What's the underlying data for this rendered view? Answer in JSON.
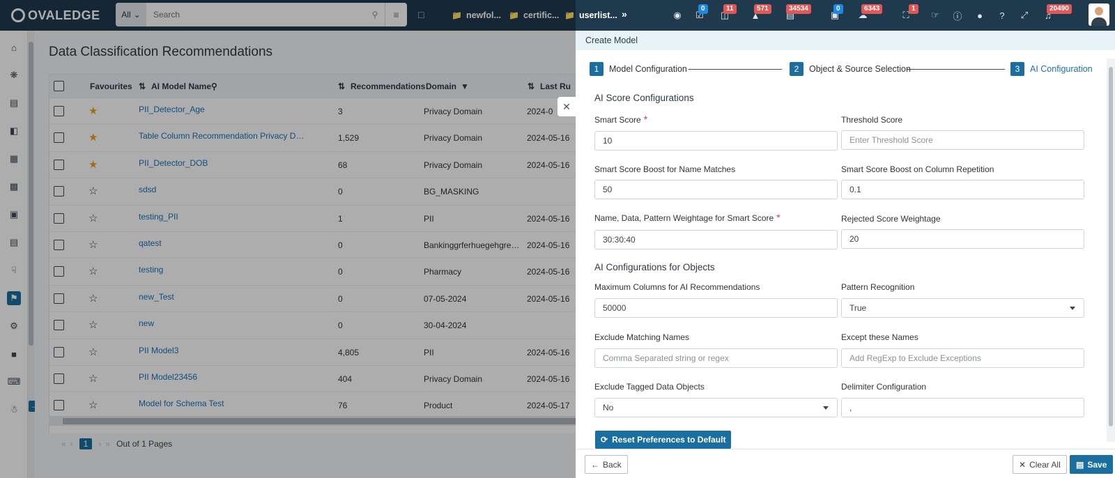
{
  "app": {
    "logo_text": "OVALEDGE"
  },
  "search": {
    "scope": "All",
    "placeholder": "Search"
  },
  "recent_tabs": [
    "newfol...",
    "certific...",
    "userlist..."
  ],
  "header_badges": {
    "b1": "0",
    "b2": "11",
    "b3": "571",
    "b4": "34534",
    "b5": "0",
    "b6": "6343",
    "b7": "1",
    "b8": "20490"
  },
  "page": {
    "title": "Data Classification Recommendations"
  },
  "table": {
    "columns": {
      "favourites": "Favourites",
      "name": "AI Model Name",
      "recs": "Recommendations",
      "domain": "Domain",
      "last_run": "Last Ru"
    },
    "rows": [
      {
        "fav": true,
        "name": "PII_Detector_Age",
        "recs": "3",
        "domain": "Privacy Domain",
        "last_run": "2024-0"
      },
      {
        "fav": true,
        "name": "Table Column Recommendation Privacy Do...",
        "recs": "1,529",
        "domain": "Privacy Domain",
        "last_run": "2024-05-16"
      },
      {
        "fav": true,
        "name": "PII_Detector_DOB",
        "recs": "68",
        "domain": "Privacy Domain",
        "last_run": "2024-05-16"
      },
      {
        "fav": false,
        "name": "sdsd",
        "recs": "0",
        "domain": "BG_MASKING",
        "last_run": ""
      },
      {
        "fav": false,
        "name": "testing_PII",
        "recs": "1",
        "domain": "PII",
        "last_run": "2024-05-16"
      },
      {
        "fav": false,
        "name": "qatest",
        "recs": "0",
        "domain": "Bankinggrferhuegehgreh...",
        "last_run": "2024-05-16"
      },
      {
        "fav": false,
        "name": "testing",
        "recs": "0",
        "domain": "Pharmacy",
        "last_run": "2024-05-16"
      },
      {
        "fav": false,
        "name": "new_Test",
        "recs": "0",
        "domain": "07-05-2024",
        "last_run": "2024-05-16"
      },
      {
        "fav": false,
        "name": "new",
        "recs": "0",
        "domain": "30-04-2024",
        "last_run": ""
      },
      {
        "fav": false,
        "name": "PII Model3",
        "recs": "4,805",
        "domain": "PII",
        "last_run": "2024-05-16"
      },
      {
        "fav": false,
        "name": "PII Model23456",
        "recs": "404",
        "domain": "Privacy Domain",
        "last_run": "2024-05-16"
      },
      {
        "fav": false,
        "name": "Model for Schema Test",
        "recs": "76",
        "domain": "Product",
        "last_run": "2024-05-17"
      }
    ]
  },
  "pager": {
    "current": "1",
    "summary": "Out of 1 Pages"
  },
  "panel": {
    "title": "Create Model",
    "steps": [
      {
        "num": "1",
        "label": "Model Configuration"
      },
      {
        "num": "2",
        "label": "Object & Source Selection"
      },
      {
        "num": "3",
        "label": "AI Configuration"
      }
    ],
    "section1": "AI Score Configurations",
    "section2": "AI Configurations for Objects",
    "fields": {
      "smart_score": {
        "label": "Smart Score",
        "value": "10"
      },
      "threshold": {
        "label": "Threshold Score",
        "placeholder": "Enter Threshold Score"
      },
      "boost_name": {
        "label": "Smart Score Boost for Name Matches",
        "value": "50"
      },
      "boost_col": {
        "label": "Smart Score Boost on Column Repetition",
        "value": "0.1"
      },
      "weightage": {
        "label": "Name, Data, Pattern Weightage for Smart Score",
        "value": "30:30:40"
      },
      "rejected": {
        "label": "Rejected Score Weightage",
        "value": "20"
      },
      "max_cols": {
        "label": "Maximum Columns for AI Recommendations",
        "value": "50000"
      },
      "pattern": {
        "label": "Pattern Recognition",
        "value": "True"
      },
      "exclude_names": {
        "label": "Exclude Matching Names",
        "placeholder": "Comma Separated string or regex"
      },
      "except_names": {
        "label": "Except these Names",
        "placeholder": "Add RegExp to Exclude Exceptions"
      },
      "exclude_tagged": {
        "label": "Exclude Tagged Data Objects",
        "value": "No"
      },
      "delimiter": {
        "label": "Delimiter Configuration",
        "value": ","
      }
    },
    "reset_label": "Reset Preferences to Default",
    "back_label": "Back",
    "clear_label": "Clear All",
    "save_label": "Save"
  }
}
